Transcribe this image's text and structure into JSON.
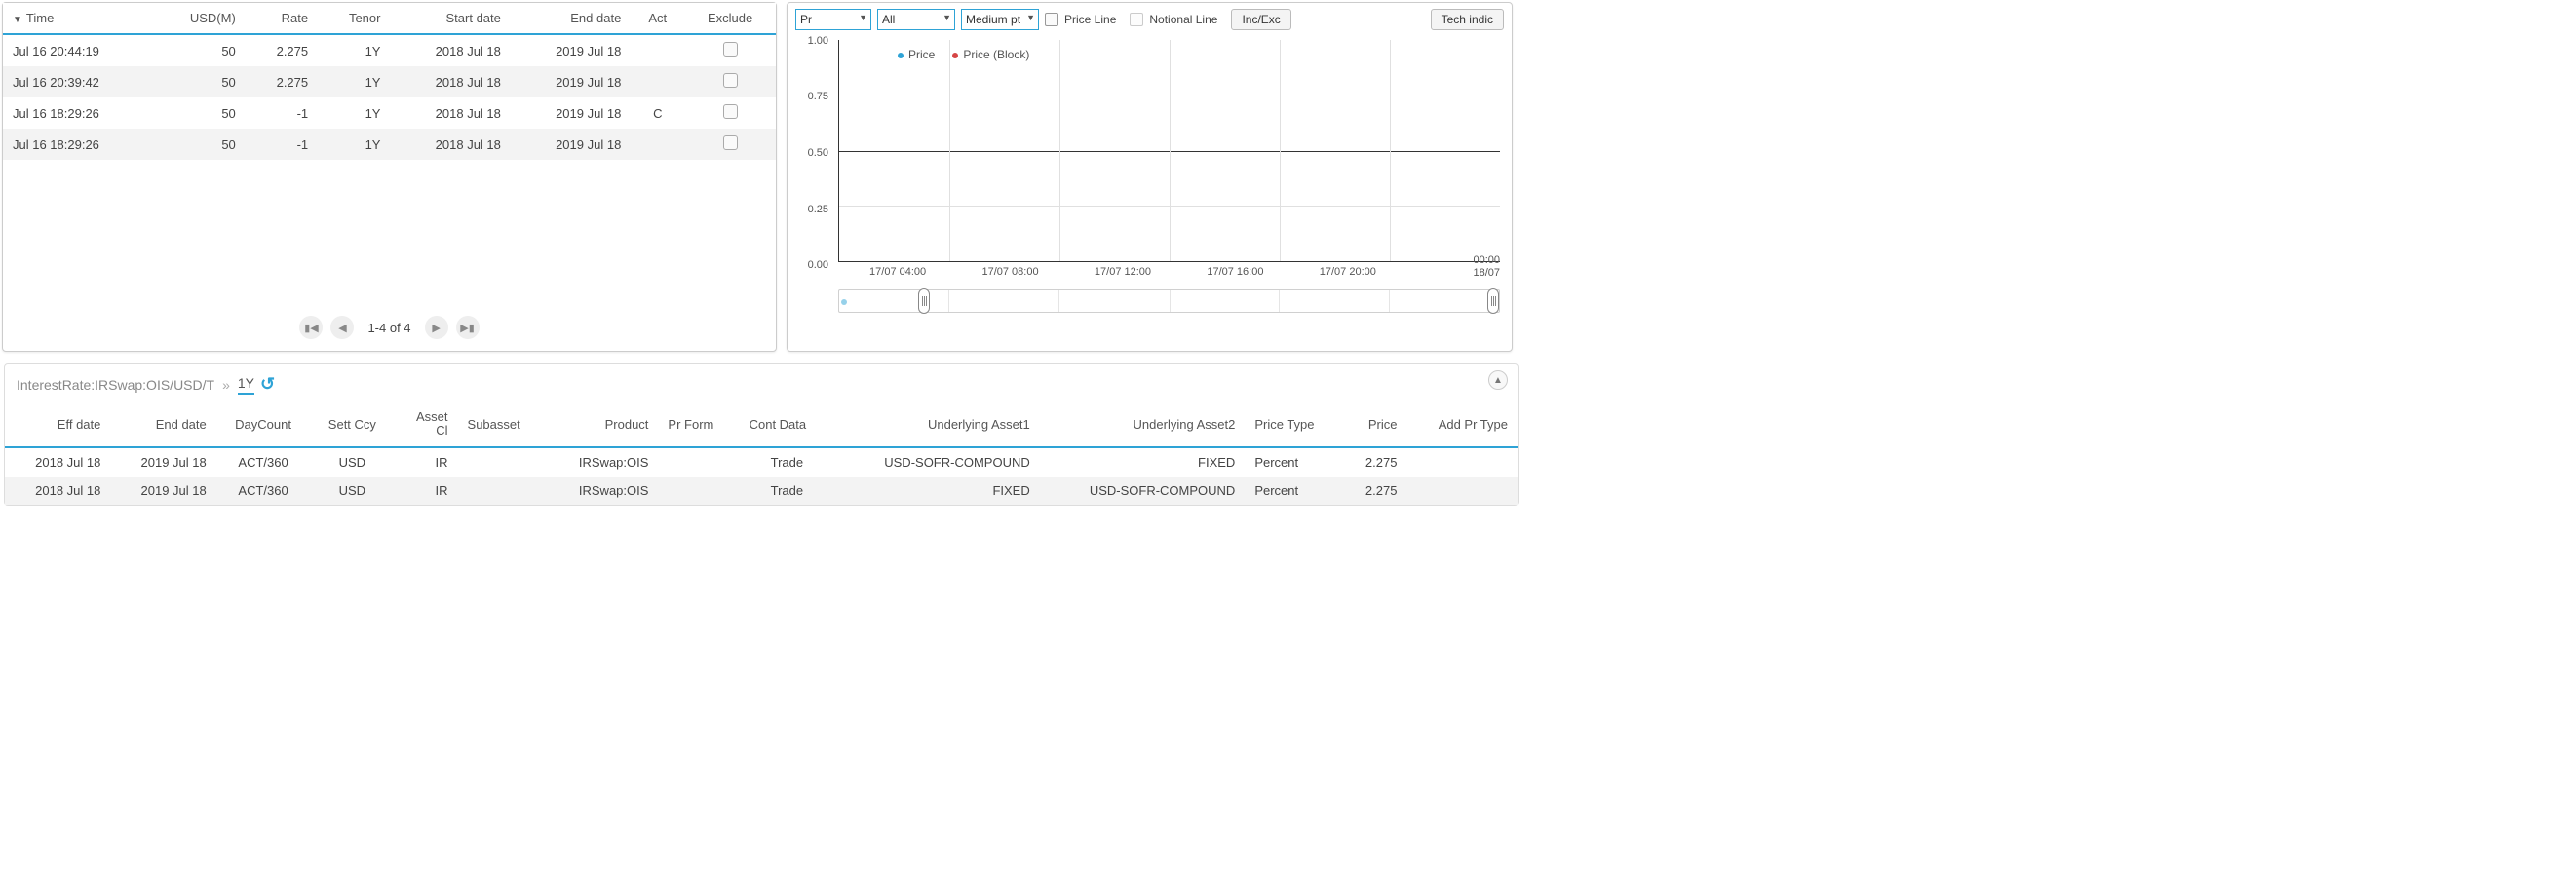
{
  "trades": {
    "headers": {
      "time": "Time",
      "usd_m": "USD(M)",
      "rate": "Rate",
      "tenor": "Tenor",
      "start_date": "Start date",
      "end_date": "End date",
      "act": "Act",
      "exclude": "Exclude"
    },
    "rows": [
      {
        "time": "Jul 16 20:44:19",
        "usd_m": "50",
        "rate": "2.275",
        "tenor": "1Y",
        "start": "2018 Jul 18",
        "end": "2019 Jul 18",
        "act": ""
      },
      {
        "time": "Jul 16 20:39:42",
        "usd_m": "50",
        "rate": "2.275",
        "tenor": "1Y",
        "start": "2018 Jul 18",
        "end": "2019 Jul 18",
        "act": ""
      },
      {
        "time": "Jul 16 18:29:26",
        "usd_m": "50",
        "rate": "-1",
        "tenor": "1Y",
        "start": "2018 Jul 18",
        "end": "2019 Jul 18",
        "act": "C"
      },
      {
        "time": "Jul 16 18:29:26",
        "usd_m": "50",
        "rate": "-1",
        "tenor": "1Y",
        "start": "2018 Jul 18",
        "end": "2019 Jul 18",
        "act": ""
      }
    ],
    "pager": "1-4 of 4"
  },
  "chart": {
    "toolbar": {
      "sel_series": "Pr",
      "sel_filter": "All",
      "sel_size": "Medium pt",
      "price_line_label": "Price Line",
      "notional_line_label": "Notional Line",
      "inc_exc_btn": "Inc/Exc",
      "tech_indic_btn": "Tech indic"
    },
    "legend": {
      "series1": "Price",
      "series2": "Price (Block)"
    },
    "y_ticks": [
      "1.00",
      "0.75",
      "0.50",
      "0.25",
      "0.00"
    ],
    "x_ticks": [
      "17/07 04:00",
      "17/07 08:00",
      "17/07 12:00",
      "17/07 16:00",
      "17/07 20:00"
    ],
    "x_end_top": "00:00",
    "x_end_bottom": "18/07"
  },
  "breadcrumb": {
    "path": "InterestRate:IRSwap:OIS/USD/T",
    "current": "1Y"
  },
  "details": {
    "headers": {
      "eff_date": "Eff date",
      "end_date": "End date",
      "daycount": "DayCount",
      "sett_ccy": "Sett Ccy",
      "asset_cl_1": "Asset",
      "asset_cl_2": "Cl",
      "subasset": "Subasset",
      "product": "Product",
      "pr_form": "Pr Form",
      "cont_data": "Cont Data",
      "under_asset1": "Underlying Asset1",
      "under_asset2": "Underlying Asset2",
      "price_type": "Price Type",
      "price": "Price",
      "add_pr_type": "Add Pr Type"
    },
    "rows": [
      {
        "eff": "2018 Jul 18",
        "end": "2019 Jul 18",
        "daycount": "ACT/360",
        "sett": "USD",
        "asset": "IR",
        "subasset": "",
        "product": "IRSwap:OIS",
        "prform": "",
        "contdata": "Trade",
        "a1": "USD-SOFR-COMPOUND",
        "a2": "FIXED",
        "ptype": "Percent",
        "price": "2.275",
        "addpr": ""
      },
      {
        "eff": "2018 Jul 18",
        "end": "2019 Jul 18",
        "daycount": "ACT/360",
        "sett": "USD",
        "asset": "IR",
        "subasset": "",
        "product": "IRSwap:OIS",
        "prform": "",
        "contdata": "Trade",
        "a1": "FIXED",
        "a2": "USD-SOFR-COMPOUND",
        "ptype": "Percent",
        "price": "2.275",
        "addpr": ""
      }
    ]
  },
  "chart_data": {
    "type": "line",
    "title": "",
    "xlabel": "",
    "ylabel": "",
    "ylim": [
      0.0,
      1.0
    ],
    "x_range": [
      "17/07 00:00",
      "18/07 00:00"
    ],
    "series": [
      {
        "name": "Price",
        "color": "#2ea3d6",
        "values": []
      },
      {
        "name": "Price (Block)",
        "color": "#d64545",
        "values": []
      }
    ],
    "y_ticks": [
      0.0,
      0.25,
      0.5,
      0.75,
      1.0
    ],
    "x_ticks": [
      "17/07 04:00",
      "17/07 08:00",
      "17/07 12:00",
      "17/07 16:00",
      "17/07 20:00",
      "18/07 00:00"
    ],
    "gridline_at": 0.5
  }
}
